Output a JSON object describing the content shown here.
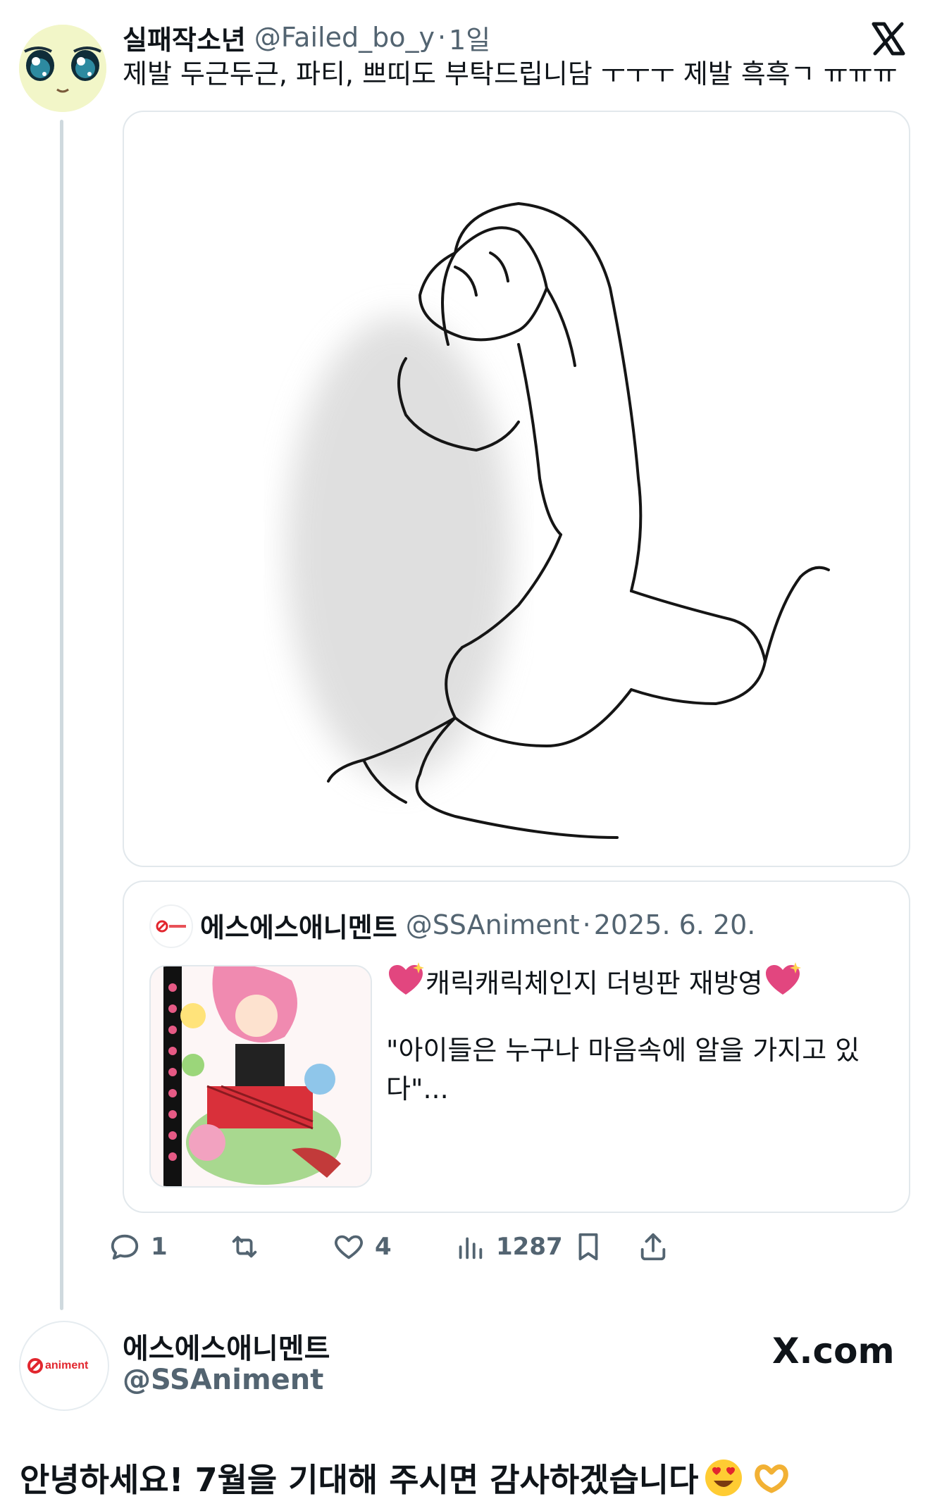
{
  "post": {
    "display_name": "실패작소년",
    "handle": "@Failed_bo_y",
    "separator": "·",
    "age": "1일",
    "text": "제발 두근두근, 파티, 쁘띠도 부탁드립니담 ㅜㅜㅜ 제발 흑흑ㄱ ㅠㅠㅠ"
  },
  "quote": {
    "display_name": "에스에스애니멘트",
    "handle": "@SSAniment",
    "separator": "·",
    "date": "2025. 6. 20.",
    "title": "캐릭캐릭체인지 더빙판 재방영",
    "body": "\"아이들은 누구나 마음속에 알을 가지고 있다\"..."
  },
  "actions": {
    "replies": "1",
    "likes": "4",
    "views": "1287"
  },
  "account": {
    "display_name": "에스에스애니멘트",
    "handle": "@SSAniment",
    "site_label": "X.com",
    "logo_text": "animent"
  },
  "reply_text": "안녕하세요! 7월을 기대해 주시면 감사하겠습니다",
  "colors": {
    "text_primary": "#0f1419",
    "text_secondary": "#536471",
    "border": "#e2e8ec",
    "heart_emoji": "#e2467f",
    "animent_red": "#e2262e"
  }
}
